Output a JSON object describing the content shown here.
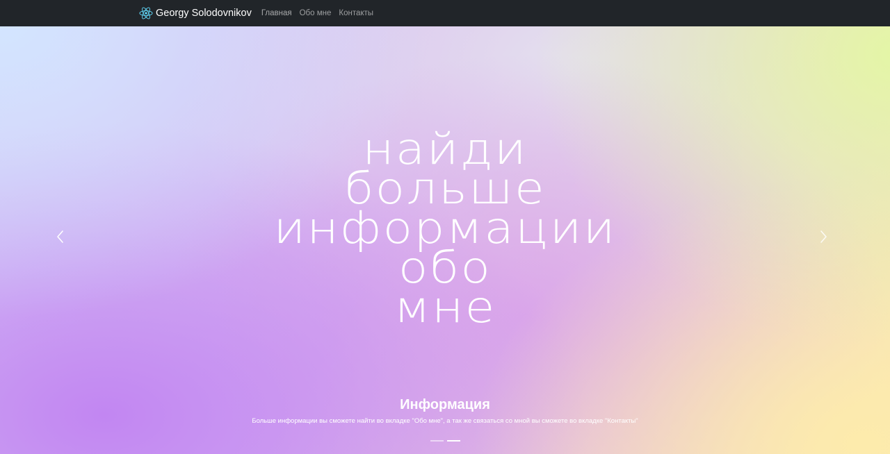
{
  "navbar": {
    "brand": "Georgy Solodovnikov",
    "brand_icon": "react-atom-icon",
    "links": [
      "Главная",
      "Обо мне",
      "Контакты"
    ]
  },
  "hero": {
    "lines": [
      "найди",
      "больше",
      "информации",
      "обо",
      "мне"
    ]
  },
  "caption": {
    "title": "Информация",
    "text": "Больше информации вы сможете найти во вкладке \"Обо мне\", а так же связаться со мной вы сможете во вкладке \"Контакты\""
  },
  "controls": {
    "prev_icon": "chevron-left-icon",
    "next_icon": "chevron-right-icon"
  },
  "indicators": {
    "count": 2,
    "active": 2
  },
  "colors": {
    "navbar": "#212529",
    "brand_icon": "#61dafb"
  }
}
